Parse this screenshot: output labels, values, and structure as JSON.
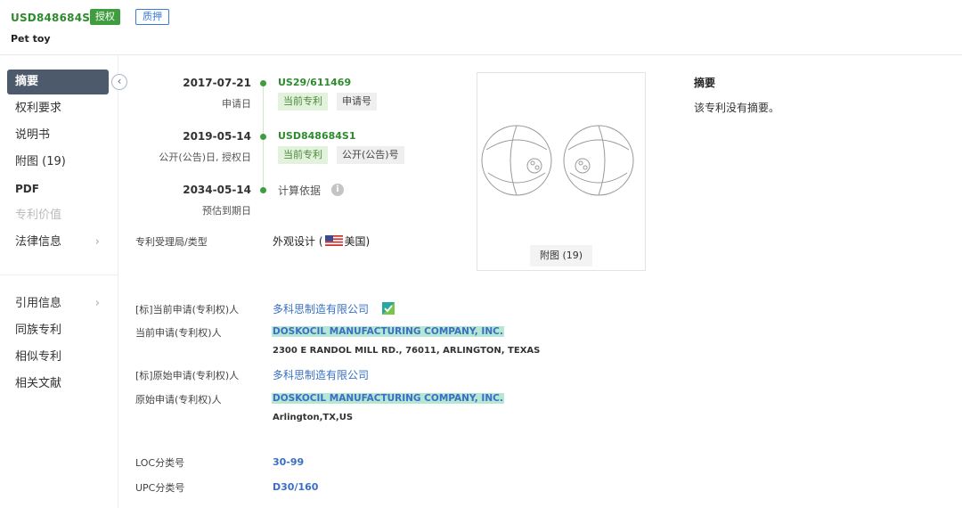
{
  "header": {
    "pub_no": "USD848684S1",
    "status_badge": "授权",
    "pledge_badge": "质押",
    "title": "Pet toy"
  },
  "sidebar": {
    "items": [
      {
        "label": "摘要"
      },
      {
        "label": "权利要求"
      },
      {
        "label": "说明书"
      },
      {
        "label": "附图 (19)"
      },
      {
        "label": "PDF"
      },
      {
        "label": "专利价值"
      },
      {
        "label": "法律信息"
      },
      {
        "label": "引用信息"
      },
      {
        "label": "同族专利"
      },
      {
        "label": "相似专利"
      },
      {
        "label": "相关文献"
      }
    ],
    "chevron": "›",
    "collapse": "‹"
  },
  "timeline": [
    {
      "date": "2017-07-21",
      "sub": "申请日",
      "code": "US29/611469",
      "tag1": "当前专利",
      "tag2": "申请号"
    },
    {
      "date": "2019-05-14",
      "sub": "公开(公告)日, 授权日",
      "code": "USD848684S1",
      "tag1": "当前专利",
      "tag2": "公开(公告)号"
    },
    {
      "date": "2034-05-14",
      "sub": "预估到期日",
      "calc": "计算依据",
      "info": "i"
    }
  ],
  "office": {
    "label": "专利受理局/类型",
    "value_prefix": "外观设计 (",
    "country": "美国)"
  },
  "applicants": {
    "std_current_label": "[标]当前申请(专利权)人",
    "std_current_value": "多科思制造有限公司",
    "current_label": "当前申请(专利权)人",
    "current_name": "DOSKOCIL MANUFACTURING COMPANY, INC.",
    "current_addr": "2300 E RANDOL MILL RD., 76011, ARLINGTON, TEXAS",
    "std_original_label": "[标]原始申请(专利权)人",
    "std_original_value": "多科思制造有限公司",
    "original_label": "原始申请(专利权)人",
    "original_name": "DOSKOCIL MANUFACTURING COMPANY, INC.",
    "original_addr": "Arlington,TX,US"
  },
  "classes": {
    "loc_label": "LOC分类号",
    "loc_value": "30-99",
    "upc_label": "UPC分类号",
    "upc_value": "D30/160"
  },
  "figure": {
    "button": "附图 (19)"
  },
  "abstract": {
    "title": "摘要",
    "text": "该专利没有摘要。"
  },
  "colors": {
    "accent_green": "#3f9d3f",
    "link_blue": "#3a6fc4",
    "highlight": "#b6e6d4",
    "nav_active": "#4c5a6c"
  }
}
